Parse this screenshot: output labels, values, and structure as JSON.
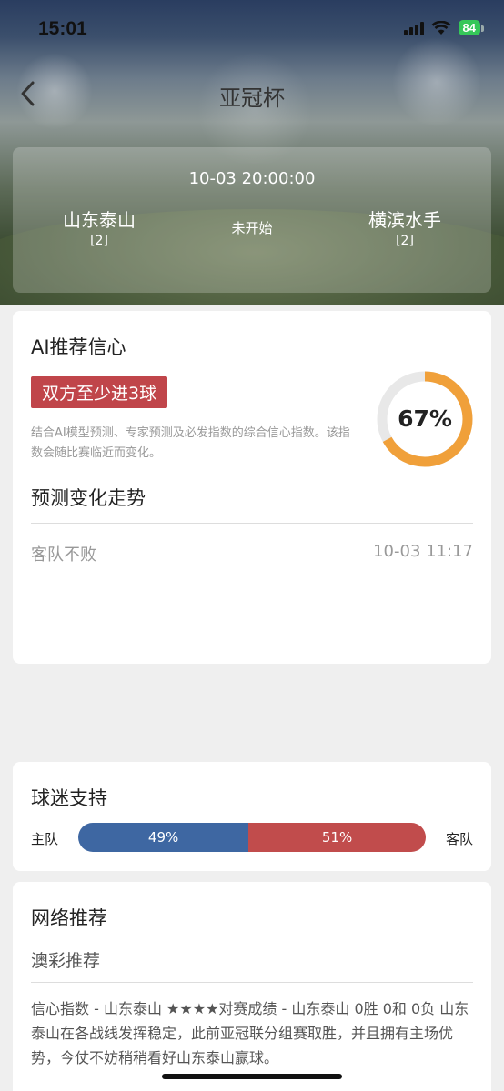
{
  "status_bar": {
    "time": "15:01",
    "battery": "84"
  },
  "nav": {
    "title": "亚冠杯"
  },
  "match": {
    "datetime": "10-03 20:00:00",
    "status": "未开始",
    "home": {
      "name": "山东泰山",
      "rank": "[2]"
    },
    "away": {
      "name": "横滨水手",
      "rank": "[2]"
    }
  },
  "ai": {
    "title": "AI推荐信心",
    "tag": "双方至少进3球",
    "description": "结合AI模型预测、专家预测及必发指数的综合信心指数。该指数会随比赛临近而变化。",
    "confidence": 0.67,
    "confidence_label": "67%",
    "trend_title": "预测变化走势",
    "trend_row": {
      "label": "客队不败",
      "time": "10-03 11:17"
    }
  },
  "fans": {
    "title": "球迷支持",
    "home_label": "主队",
    "away_label": "客队",
    "home_pct": 49,
    "away_pct": 51,
    "home_pct_label": "49%",
    "away_pct_label": "51%"
  },
  "network": {
    "title": "网络推荐",
    "subtitle": "澳彩推荐",
    "body": "信心指数 - 山东泰山 ★★★★对赛成绩 - 山东泰山 0胜 0和 0负 山东泰山在各战线发挥稳定，此前亚冠联分组赛取胜，并且拥有主场优势，今仗不妨稍稍看好山东泰山赢球。"
  },
  "colors": {
    "tag_red": "#c0454a",
    "ring_orange": "#f0a03a",
    "ring_track": "#e8e8e8",
    "home_blue": "#3e67a2",
    "away_red": "#c14c4c"
  }
}
